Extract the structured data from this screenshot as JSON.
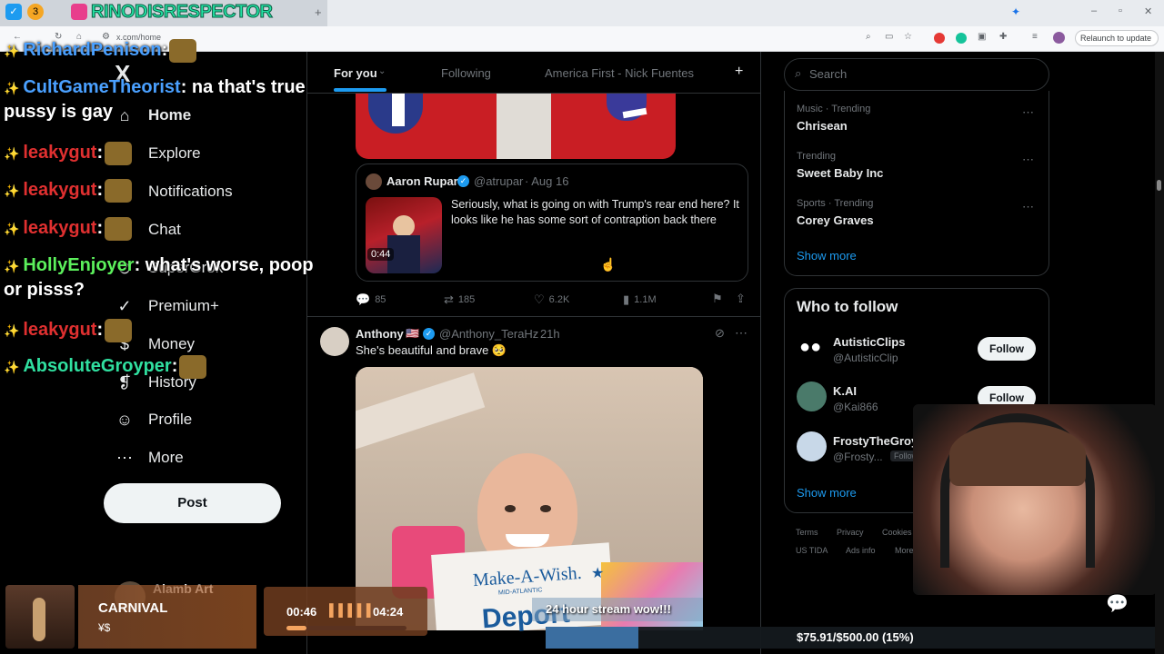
{
  "browser": {
    "url": "x.com/home",
    "relaunch_label": "Relaunch to update"
  },
  "overlay": {
    "stream_title": "RINODISRESPECTOR",
    "badge_count": "3",
    "song_title": "CARNIVAL",
    "song_artist": "¥$",
    "player_current": "00:46",
    "player_total": "04:24",
    "player_progress": 0.17,
    "banner": "24 hour stream wow!!!",
    "goal_text": "$75.91/$500.00 (15%)",
    "goal_progress": 0.15
  },
  "chat": [
    {
      "user": "RichardPenison",
      "msg": ":",
      "color": "#4aa0ff"
    },
    {
      "user": "CultGameTheorist",
      "msg": ": na that's true pussy is gay",
      "color": "#4aa0ff"
    },
    {
      "user": "leakygut",
      "msg": ":",
      "color": "#e03030"
    },
    {
      "user": "leakygut",
      "msg": ":",
      "color": "#e03030"
    },
    {
      "user": "leakygut",
      "msg": ":",
      "color": "#e03030"
    },
    {
      "user": "HollyEnjoyer",
      "msg": ": what's worse, poop or pisss?",
      "color": "#5cf05c"
    },
    {
      "user": "leakygut",
      "msg": ":",
      "color": "#e03030"
    },
    {
      "user": "AbsoluteGroyper",
      "msg": ":",
      "color": "#30e0a0"
    }
  ],
  "nav": {
    "logo": "X",
    "items": [
      {
        "label": "Home",
        "icon": "home-icon",
        "glyph": "⌂"
      },
      {
        "label": "Explore",
        "icon": "search-icon",
        "glyph": "⌕"
      },
      {
        "label": "Notifications",
        "icon": "bell-icon",
        "glyph": "⍾"
      },
      {
        "label": "Chat",
        "icon": "chat-icon",
        "glyph": "✉"
      },
      {
        "label": "SuperGrok",
        "icon": "grok-icon",
        "glyph": "⊘"
      },
      {
        "label": "Premium+",
        "icon": "premium-icon",
        "glyph": "✓"
      },
      {
        "label": "Money",
        "icon": "money-icon",
        "glyph": "$"
      },
      {
        "label": "History",
        "icon": "bookmark-icon",
        "glyph": "❡"
      },
      {
        "label": "Profile",
        "icon": "person-icon",
        "glyph": "☺"
      },
      {
        "label": "More",
        "icon": "more-icon",
        "glyph": "⋯"
      }
    ],
    "post_label": "Post",
    "account_name": "Alamb Art"
  },
  "tabs": [
    {
      "label": "For you",
      "active": true
    },
    {
      "label": "Following",
      "active": false
    },
    {
      "label": "America First - Nick Fuentes",
      "active": false
    }
  ],
  "tab_add": "+",
  "post1": {
    "quote": {
      "name": "Aaron Rupar",
      "handle": "@atrupar",
      "date": "· Aug 16",
      "text": "Seriously, what is going on with Trump's rear end here? It looks like he has some sort of contraption back there",
      "video_time": "0:44"
    },
    "replies": "85",
    "reposts": "185",
    "likes": "6.2K",
    "views": "1.1M"
  },
  "post2": {
    "name": "Anthony",
    "flag": "🇺🇸",
    "handle": "@Anthony_TeraHz",
    "time": "· 21h",
    "text": "She's beautiful and brave 🥺",
    "sign_top": "Make-A-Wish.",
    "sign_sub": "MID-ATLANTIC",
    "sign_bottom": "Deport"
  },
  "search": {
    "placeholder": "Search"
  },
  "trends": [
    {
      "meta": "Music · Trending",
      "name": "Chrisean"
    },
    {
      "meta": "Trending",
      "name": "Sweet Baby Inc"
    },
    {
      "meta": "Sports · Trending",
      "name": "Corey Graves"
    }
  ],
  "trends_show_more": "Show more",
  "who_to_follow": {
    "title": "Who to follow",
    "accounts": [
      {
        "name": "AutisticClips",
        "handle": "@AutisticClip",
        "button": "Follow",
        "follows_you": ""
      },
      {
        "name": "K.AI",
        "handle": "@Kai866",
        "button": "Follow",
        "follows_you": ""
      },
      {
        "name": "FrostyTheGroy...",
        "handle": "@Frosty...",
        "button": "",
        "follows_you": "Follows you"
      }
    ],
    "show_more": "Show more"
  },
  "footer": {
    "links": [
      "Terms",
      "Privacy",
      "Cookies",
      "US TIDA",
      "Ads info",
      "More"
    ]
  },
  "colors": {
    "accent": "#1d9bf0",
    "background": "#000000",
    "border": "#2f3336",
    "muted": "#71767b"
  }
}
